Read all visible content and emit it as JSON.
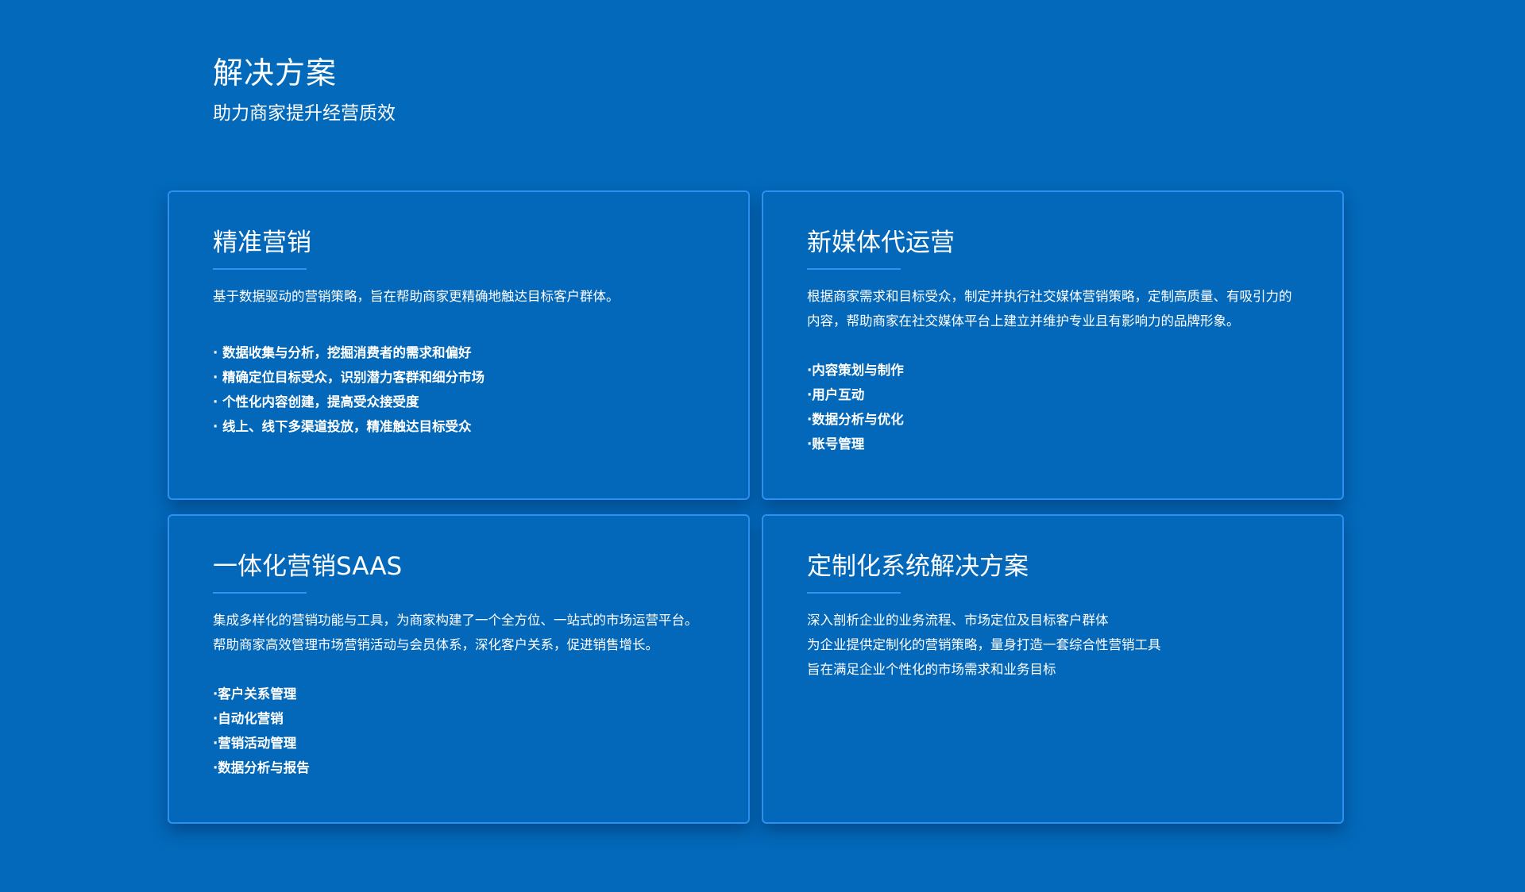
{
  "header": {
    "title": "解决方案",
    "subtitle": "助力商家提升经营质效"
  },
  "cards": [
    {
      "title": "精准营销",
      "description": [
        "基于数据驱动的营销策略，旨在帮助商家更精确地触达目标客户群体。"
      ],
      "bullets": [
        "· 数据收集与分析，挖掘消费者的需求和偏好",
        "· 精确定位目标受众，识别潜力客群和细分市场",
        "· 个性化内容创建，提高受众接受度",
        "· 线上、线下多渠道投放，精准触达目标受众"
      ]
    },
    {
      "title": "新媒体代运营",
      "description": [
        "根据商家需求和目标受众，制定并执行社交媒体营销策略，定制高质量、有吸引力的",
        "内容，帮助商家在社交媒体平台上建立并维护专业且有影响力的品牌形象。"
      ],
      "bullets": [
        "·内容策划与制作",
        "·用户互动",
        "·数据分析与优化",
        "·账号管理"
      ]
    },
    {
      "title": "一体化营销SAAS",
      "description": [
        "集成多样化的营销功能与工具，为商家构建了一个全方位、一站式的市场运营平台。",
        "帮助商家高效管理市场营销活动与会员体系，深化客户关系，促进销售增长。"
      ],
      "bullets": [
        "·客户关系管理",
        "·自动化营销",
        "·营销活动管理",
        "·数据分析与报告"
      ]
    },
    {
      "title": "定制化系统解决方案",
      "description": [
        "深入剖析企业的业务流程、市场定位及目标客户群体",
        "为企业提供定制化的营销策略，量身打造一套综合性营销工具",
        "旨在满足企业个性化的市场需求和业务目标"
      ],
      "bullets": []
    }
  ]
}
